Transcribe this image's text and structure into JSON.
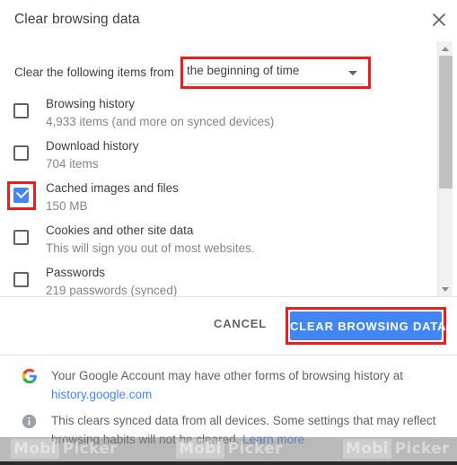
{
  "dialog": {
    "title": "Clear browsing data",
    "close_icon": "close-icon"
  },
  "time_range": {
    "label": "Clear the following items from",
    "selected": "the beginning of time",
    "dropdown_icon": "chevron-down-icon"
  },
  "items": [
    {
      "title": "Browsing history",
      "subtitle": "4,933 items (and more on synced devices)",
      "checked": false,
      "highlighted": false
    },
    {
      "title": "Download history",
      "subtitle": "704 items",
      "checked": false,
      "highlighted": false
    },
    {
      "title": "Cached images and files",
      "subtitle": "150 MB",
      "checked": true,
      "highlighted": true
    },
    {
      "title": "Cookies and other site data",
      "subtitle": "This will sign you out of most websites.",
      "checked": false,
      "highlighted": false
    },
    {
      "title": "Passwords",
      "subtitle": "219 passwords (synced)",
      "checked": false,
      "highlighted": false
    }
  ],
  "scrollbar": {
    "up_icon": "scroll-up-arrow-icon",
    "down_icon": "scroll-down-arrow-icon"
  },
  "actions": {
    "cancel_label": "CANCEL",
    "confirm_label": "CLEAR BROWSING DATA"
  },
  "footer": {
    "google_text": "Your Google Account may have other forms of browsing history at",
    "google_link": "history.google.com",
    "google_icon": "google-g-logo-icon",
    "info_icon": "info-circle-icon",
    "info_text": "This clears synced data from all devices. Some settings that may reflect browsing habits will not be cleared.",
    "info_link": "Learn more"
  },
  "watermark": {
    "brand_first": "Mobi",
    "brand_second": "Picker"
  },
  "colors": {
    "accent_blue": "#4285f4",
    "annotation_red": "#ee1c1c",
    "primary_text": "#3c4043",
    "secondary_text": "#80868b"
  }
}
